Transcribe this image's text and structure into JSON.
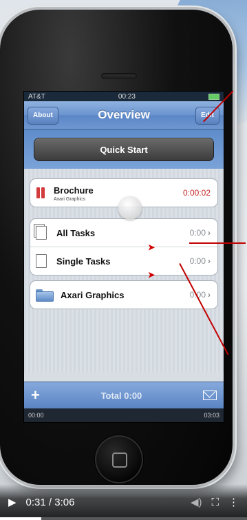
{
  "device": {
    "status": {
      "carrier": "AT&T",
      "time": "00:23"
    },
    "navbar": {
      "title": "Overview",
      "left_button": "About",
      "right_button": "Edit"
    },
    "quick_start": "Quick Start",
    "active_task": {
      "name": "Brochure",
      "client": "Axari Graphics",
      "time": "0:00:02"
    },
    "task_groups": [
      {
        "label": "All Tasks",
        "time": "0:00"
      },
      {
        "label": "Single Tasks",
        "time": "0:00"
      }
    ],
    "projects": [
      {
        "label": "Axari Graphics",
        "time": "0:00"
      }
    ],
    "toolbar": {
      "add": "+",
      "total": "Total 0:00"
    },
    "player_bar": {
      "left": "00:00",
      "right": "03:03"
    }
  },
  "video": {
    "current": "0:31",
    "duration": "3:06",
    "time_display": "0:31 / 3:06",
    "progress": 0.168
  },
  "colors": {
    "accent": "#6b94cf",
    "red": "#c42b2b",
    "annotation": "#c00000"
  }
}
